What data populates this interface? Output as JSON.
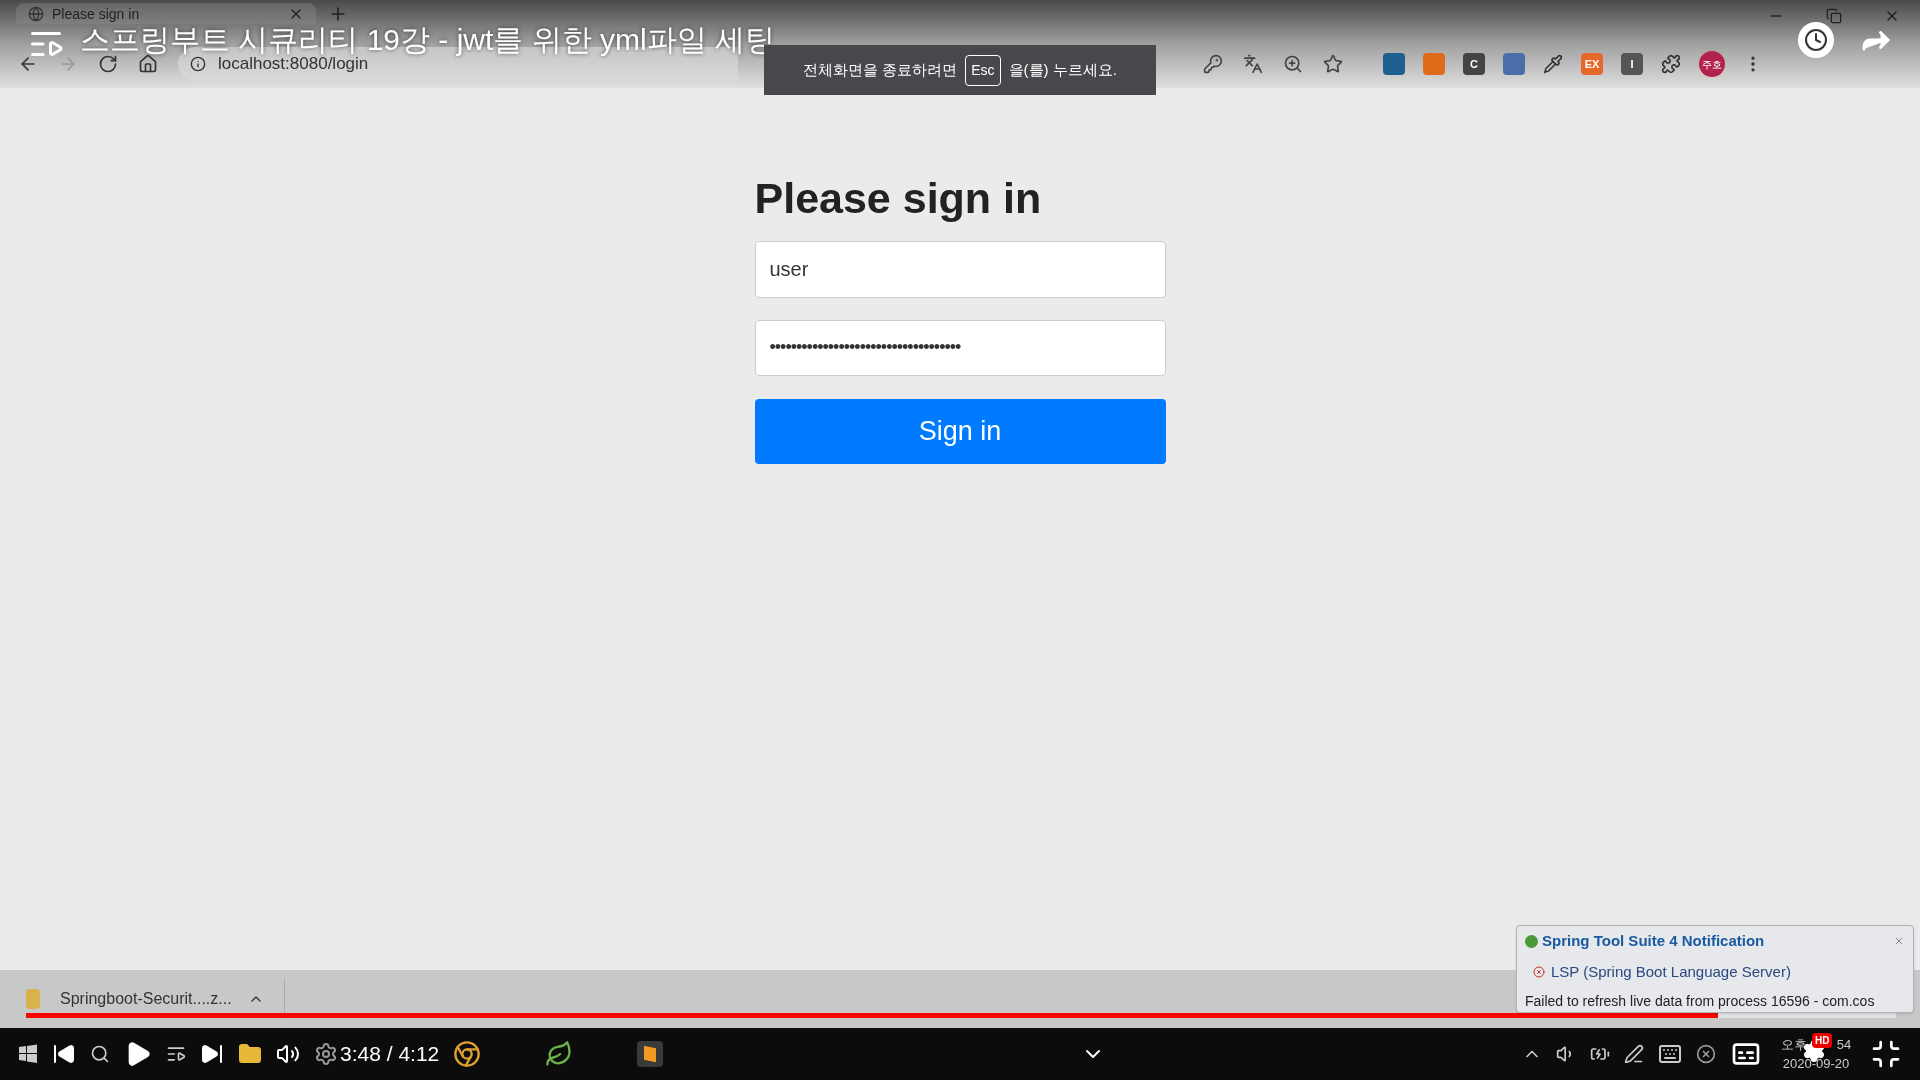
{
  "browser": {
    "tab": {
      "title": "Please sign in",
      "selected": true
    },
    "url": "localhost:8080/login",
    "extensions": [
      {
        "color": "#1f5f8f"
      },
      {
        "color": "#e06a1a"
      },
      {
        "label": "C",
        "color": "#444444"
      },
      {
        "color": "#4a6fa8"
      },
      {
        "label": "EX",
        "color": "#e8682a"
      },
      {
        "label": "I",
        "color": "#555555"
      }
    ],
    "profile": "주호"
  },
  "video": {
    "title": "스프링부트 시큐리티 19강 - jwt를 위한 yml파일 세팅",
    "time": "3:48 / 4:12",
    "level": 0.905,
    "quality": "HD"
  },
  "fullscreen_toast": {
    "before": "전체화면을 종료하려면",
    "key": "Esc",
    "after": "을(를) 누르세요."
  },
  "form": {
    "heading": "Please sign in",
    "username": "user",
    "password": "••••••••••••••••••••••••••••••••••••",
    "button": "Sign in"
  },
  "download": {
    "file": "Springboot-Securit....z..."
  },
  "notification": {
    "title": "Spring Tool Suite 4 Notification",
    "source": "LSP (Spring Boot Language Server)",
    "message": "Failed to refresh live data from process 16596 - com.cos"
  },
  "taskbar": {
    "clock": "오후",
    "minutes": "54",
    "date": "2020-09-20"
  }
}
